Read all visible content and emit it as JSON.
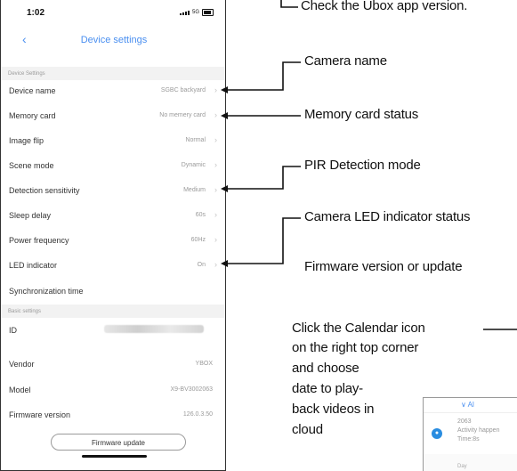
{
  "status_bar": {
    "time": "1:02",
    "network": "5G"
  },
  "nav": {
    "title": "Device settings",
    "back_glyph": "‹"
  },
  "sections": {
    "device": "Device Settings",
    "basic": "Basic settings"
  },
  "device_settings": [
    {
      "label": "Device name",
      "value": "SGBC backyard"
    },
    {
      "label": "Memory card",
      "value": "No memery card"
    },
    {
      "label": "Image flip",
      "value": "Normal"
    },
    {
      "label": "Scene mode",
      "value": "Dynamic"
    },
    {
      "label": "Detection sensitivity",
      "value": "Medium"
    },
    {
      "label": "Sleep delay",
      "value": "60s"
    },
    {
      "label": "Power frequency",
      "value": "60Hz"
    },
    {
      "label": "LED indicator",
      "value": "On"
    },
    {
      "label": "Synchronization time",
      "value": ""
    }
  ],
  "basic_settings": [
    {
      "label": "ID",
      "value": ""
    },
    {
      "label": "Vendor",
      "value": "YBOX"
    },
    {
      "label": "Model",
      "value": "X9-BV3002063"
    },
    {
      "label": "Firmware version",
      "value": "126.0.3.50"
    }
  ],
  "firmware_button": "Firmware update",
  "annotations": {
    "ubox_version": "Check the Ubox app version.",
    "camera_name": "Camera name",
    "memory_card": "Memory card status",
    "pir": "PIR Detection mode",
    "led": "Camera LED indicator status",
    "firmware": "Firmware version or update",
    "calendar_lines": [
      "Click the Calendar icon",
      "on the right  top corner",
      "and choose",
      "date to play-",
      "back videos in",
      "cloud"
    ]
  },
  "calendar_snippet": {
    "header": "∨ Al",
    "id": "2063",
    "activity": "Activity happen",
    "time": "Time:8s",
    "day": "Day"
  },
  "icons": {
    "chevron": "›",
    "bell": "bell-icon"
  },
  "colors": {
    "accent": "#4a8ff0",
    "section_bg": "#f2f2f2",
    "value_text": "#9a9a9a"
  }
}
